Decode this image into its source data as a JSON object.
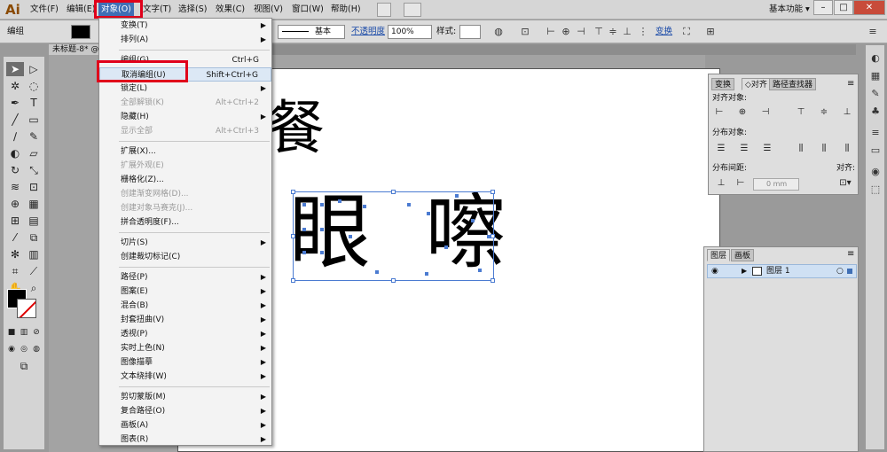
{
  "app_logo": "Ai",
  "menubar": {
    "items": [
      "文件(F)",
      "编辑(E)",
      "对象(O)",
      "文字(T)",
      "选择(S)",
      "效果(C)",
      "视图(V)",
      "窗口(W)",
      "帮助(H)"
    ],
    "workspace": "基本功能",
    "workspace_arrow": "▾",
    "minimize": "–",
    "maximize": "□",
    "close": "✕"
  },
  "controlbar": {
    "selection_label": "编组",
    "stroke_style": "基本",
    "opacity_label": "不透明度",
    "opacity_value": "100%",
    "style_label": "样式:",
    "transform_label": "变换"
  },
  "document_tab": "未标题-8* @",
  "canvas": {
    "top_glyph": "餐",
    "word": "眼 嚓"
  },
  "object_menu": {
    "items": [
      {
        "label": "变换(T)",
        "shortcut": "",
        "submenu": true,
        "disabled": false
      },
      {
        "label": "排列(A)",
        "shortcut": "",
        "submenu": true,
        "disabled": false
      },
      {
        "label": "编组(G)",
        "shortcut": "Ctrl+G",
        "submenu": false,
        "disabled": false
      },
      {
        "label": "取消编组(U)",
        "shortcut": "Shift+Ctrl+G",
        "submenu": false,
        "disabled": false
      },
      {
        "label": "锁定(L)",
        "shortcut": "",
        "submenu": true,
        "disabled": false
      },
      {
        "label": "全部解锁(K)",
        "shortcut": "Alt+Ctrl+2",
        "submenu": false,
        "disabled": true
      },
      {
        "label": "隐藏(H)",
        "shortcut": "",
        "submenu": true,
        "disabled": false
      },
      {
        "label": "显示全部",
        "shortcut": "Alt+Ctrl+3",
        "submenu": false,
        "disabled": true
      },
      {
        "label": "扩展(X)...",
        "shortcut": "",
        "submenu": false,
        "disabled": false
      },
      {
        "label": "扩展外观(E)",
        "shortcut": "",
        "submenu": false,
        "disabled": true
      },
      {
        "label": "栅格化(Z)...",
        "shortcut": "",
        "submenu": false,
        "disabled": false
      },
      {
        "label": "创建渐变网格(D)...",
        "shortcut": "",
        "submenu": false,
        "disabled": true
      },
      {
        "label": "创建对象马赛克(J)...",
        "shortcut": "",
        "submenu": false,
        "disabled": true
      },
      {
        "label": "拼合透明度(F)...",
        "shortcut": "",
        "submenu": false,
        "disabled": false
      },
      {
        "label": "切片(S)",
        "shortcut": "",
        "submenu": true,
        "disabled": false
      },
      {
        "label": "创建裁切标记(C)",
        "shortcut": "",
        "submenu": false,
        "disabled": false
      },
      {
        "label": "路径(P)",
        "shortcut": "",
        "submenu": true,
        "disabled": false
      },
      {
        "label": "图案(E)",
        "shortcut": "",
        "submenu": true,
        "disabled": false
      },
      {
        "label": "混合(B)",
        "shortcut": "",
        "submenu": true,
        "disabled": false
      },
      {
        "label": "封套扭曲(V)",
        "shortcut": "",
        "submenu": true,
        "disabled": false
      },
      {
        "label": "透视(P)",
        "shortcut": "",
        "submenu": true,
        "disabled": false
      },
      {
        "label": "实时上色(N)",
        "shortcut": "",
        "submenu": true,
        "disabled": false
      },
      {
        "label": "图像描摹",
        "shortcut": "",
        "submenu": true,
        "disabled": false
      },
      {
        "label": "文本绕排(W)",
        "shortcut": "",
        "submenu": true,
        "disabled": false
      },
      {
        "label": "剪切蒙版(M)",
        "shortcut": "",
        "submenu": true,
        "disabled": false
      },
      {
        "label": "复合路径(O)",
        "shortcut": "",
        "submenu": true,
        "disabled": false
      },
      {
        "label": "画板(A)",
        "shortcut": "",
        "submenu": true,
        "disabled": false
      },
      {
        "label": "图表(R)",
        "shortcut": "",
        "submenu": true,
        "disabled": false
      }
    ]
  },
  "align_panel": {
    "tabs": [
      "变换",
      "对齐",
      "路径查找器"
    ],
    "align_objects": "对齐对象:",
    "distribute_objects": "分布对象:",
    "distribute_spacing": "分布间距:",
    "align_to": "对齐:",
    "spacing_value": "0 mm"
  },
  "layers_panel": {
    "tabs": [
      "图层",
      "画板"
    ],
    "layer_name": "图层 1"
  },
  "colors": {
    "highlight": "#e0001a",
    "menu_active": "#3f6fb5",
    "selection": "#4b7bd1"
  }
}
